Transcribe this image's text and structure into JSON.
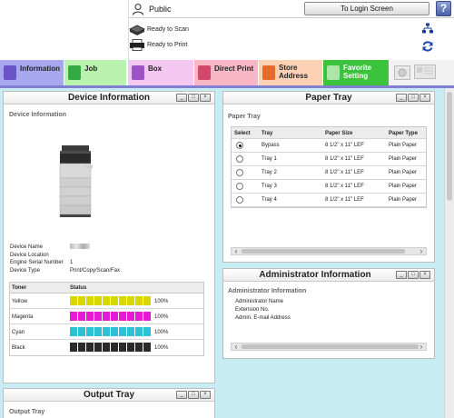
{
  "header": {
    "user_name": "Public",
    "login_label": "To Login Screen",
    "help_label": "?",
    "status": [
      {
        "icon": "scanner-icon",
        "text": "Ready to Scan"
      },
      {
        "icon": "printer-icon",
        "text": "Ready to Print"
      }
    ]
  },
  "tabs": [
    {
      "label": "Information",
      "icon": "information-icon",
      "bg": "#a8a8ee",
      "icon_color": "#6a55c8"
    },
    {
      "label": "Job",
      "icon": "job-icon",
      "bg": "#b9f2ae",
      "icon_color": "#33aa44"
    },
    {
      "label": "Box",
      "icon": "box-icon",
      "bg": "#f3c7f1",
      "icon_color": "#9c52c4"
    },
    {
      "label": "Direct Print",
      "icon": "direct-print-icon",
      "bg": "#f9b6c7",
      "icon_color": "#d4476c"
    },
    {
      "label": "Store Address",
      "line1": "Store",
      "line2": "Address",
      "icon": "store-address-icon",
      "bg": "#fcd1b4",
      "icon_color": "#e46b2a"
    },
    {
      "label": "Favorite Setting",
      "line1": "Favorite",
      "line2": "Setting",
      "icon": "favorite-setting-icon",
      "bg": "#3cc33c",
      "icon_color": "#a9e7a9"
    }
  ],
  "device_info": {
    "title": "Device Information",
    "section": "Device Information",
    "fields": [
      {
        "key": "Device Name",
        "value": ""
      },
      {
        "key": "Device Location",
        "value": ""
      },
      {
        "key": "Engine Serial Number",
        "value": "1"
      },
      {
        "key": "Device Type",
        "value": "Print/Copy/Scan/Fax"
      }
    ],
    "toner_header": {
      "name": "Toner",
      "status": "Status"
    },
    "toners": [
      {
        "name": "Yellow",
        "color": "#d8d800",
        "level_pct": 100,
        "label": "100%"
      },
      {
        "name": "Magenta",
        "color": "#e619d6",
        "level_pct": 100,
        "label": "100%"
      },
      {
        "name": "Cyan",
        "color": "#2cc1d4",
        "level_pct": 100,
        "label": "100%"
      },
      {
        "name": "Black",
        "color": "#2a2a2a",
        "level_pct": 100,
        "label": "100%"
      }
    ]
  },
  "paper_tray": {
    "title": "Paper Tray",
    "section": "Paper Tray",
    "columns": [
      "Select",
      "Tray",
      "Paper Size",
      "Paper Type"
    ],
    "rows": [
      {
        "tray": "Bypass",
        "size": "8 1/2\" x 11\" LEF",
        "type": "Plain Paper",
        "selected": true
      },
      {
        "tray": "Tray 1",
        "size": "8 1/2\" x 11\" LEF",
        "type": "Plain Paper",
        "selected": false
      },
      {
        "tray": "Tray 2",
        "size": "8 1/2\" x 11\" LEF",
        "type": "Plain Paper",
        "selected": false
      },
      {
        "tray": "Tray 3",
        "size": "8 1/2\" x 11\" LEF",
        "type": "Plain Paper",
        "selected": false
      },
      {
        "tray": "Tray 4",
        "size": "8 1/2\" x 11\" LEF",
        "type": "Plain Paper",
        "selected": false
      }
    ]
  },
  "admin_info": {
    "title": "Administrator Information",
    "section": "Administrator Information",
    "fields": [
      "Administrator Name",
      "Extension No.",
      "Admin. E-mail Address"
    ]
  },
  "output_tray": {
    "title": "Output Tray",
    "section": "Output Tray"
  },
  "window_buttons": {
    "minimize": "_",
    "restore": "□",
    "close": "×"
  }
}
